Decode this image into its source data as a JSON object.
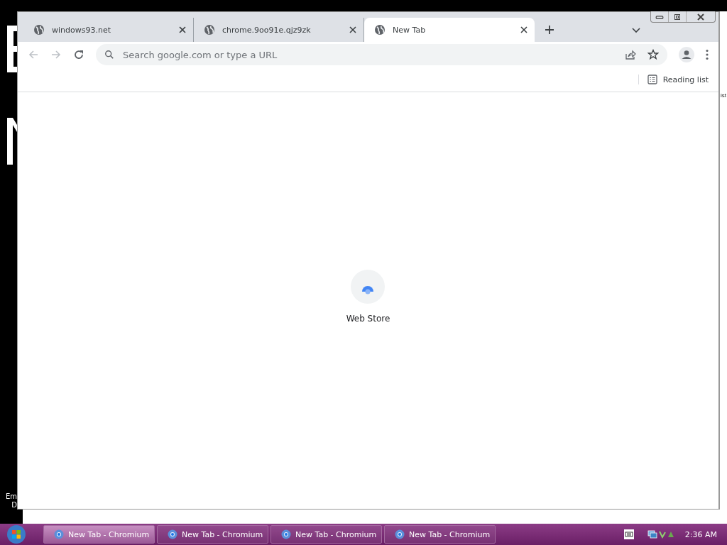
{
  "browser": {
    "tabs": [
      {
        "title": "windows93.net",
        "selected": false
      },
      {
        "title": "chrome.9oo91e.qjz9zk",
        "selected": false
      },
      {
        "title": "New Tab",
        "selected": true
      }
    ],
    "nav": {
      "back_disabled": true,
      "forward_disabled": true
    },
    "omnibox": {
      "placeholder": "Search google.com or type a URL"
    },
    "reading_list": "Reading list",
    "shortcuts": [
      {
        "label": "Web Store"
      }
    ]
  },
  "desktop_fragments": {
    "left_small": [
      "Em",
      "D"
    ],
    "right": "ist"
  },
  "taskbar": {
    "buttons": [
      {
        "label": "New Tab - Chromium",
        "selected": true
      },
      {
        "label": "New Tab - Chromium",
        "selected": false
      },
      {
        "label": "New Tab - Chromium",
        "selected": false
      },
      {
        "label": "New Tab - Chromium",
        "selected": false
      }
    ],
    "clock": "2:36 AM"
  }
}
